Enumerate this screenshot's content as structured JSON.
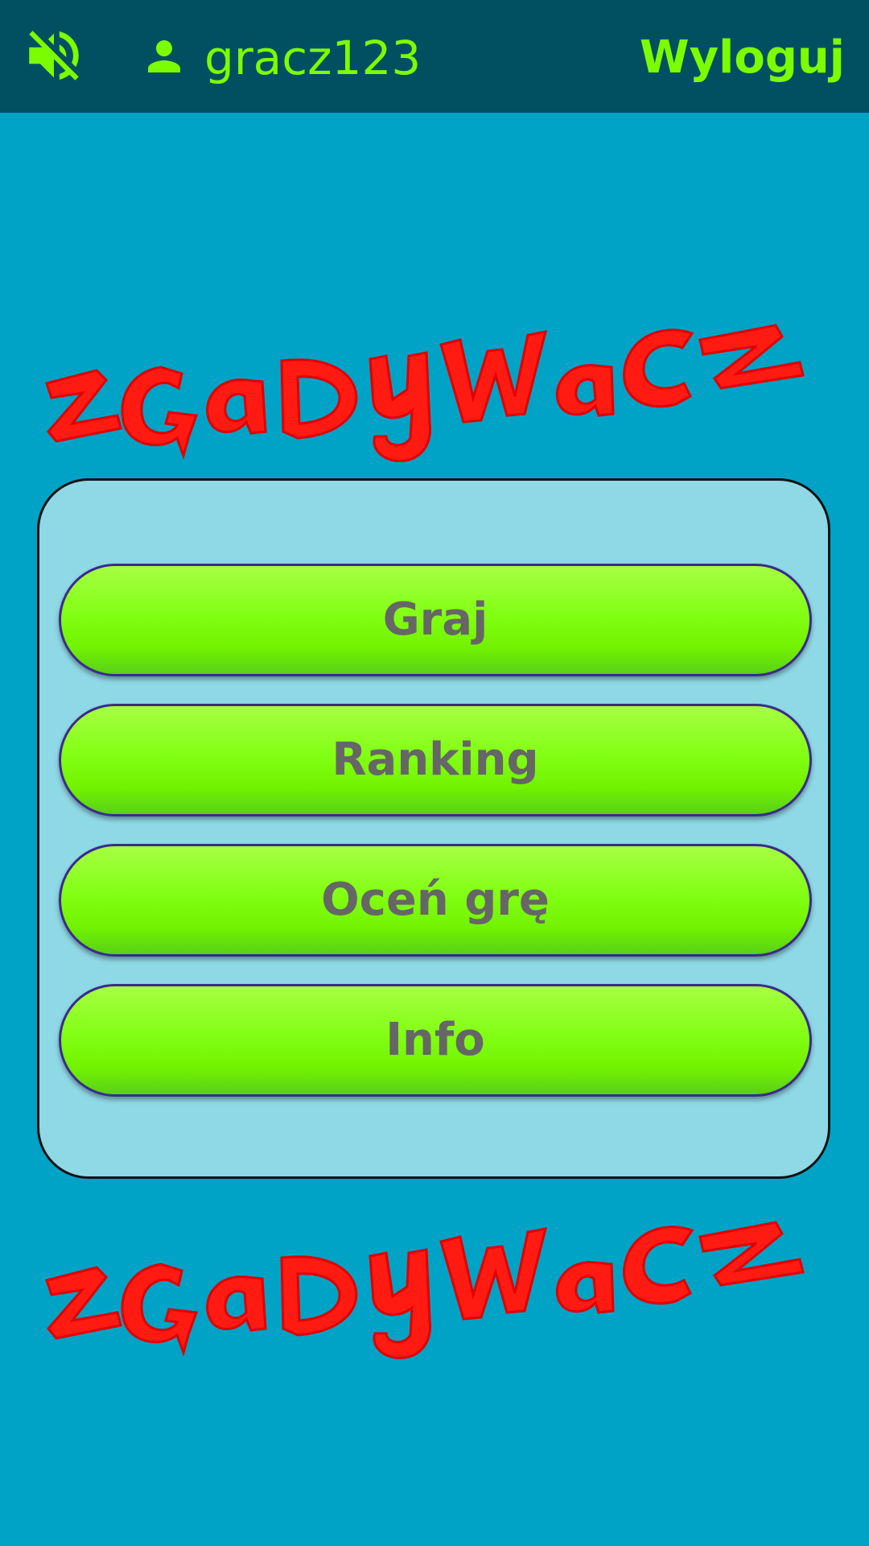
{
  "header": {
    "mute_icon": "volume-off-icon",
    "user_icon": "person-icon",
    "username": "gracz123",
    "logout_label": "Wyloguj",
    "text_color": "#7cfc00",
    "bar_color": "#005062"
  },
  "logo": {
    "text": "zgadywacz",
    "color": "#ff0000"
  },
  "menu": {
    "play_label": "Graj",
    "ranking_label": "Ranking",
    "rate_label": "Oceń grę",
    "info_label": "Info"
  },
  "colors": {
    "background": "#00a3c6",
    "panel": "#8fd8e6",
    "button_green": "#7cfc00",
    "button_text": "#666666"
  }
}
